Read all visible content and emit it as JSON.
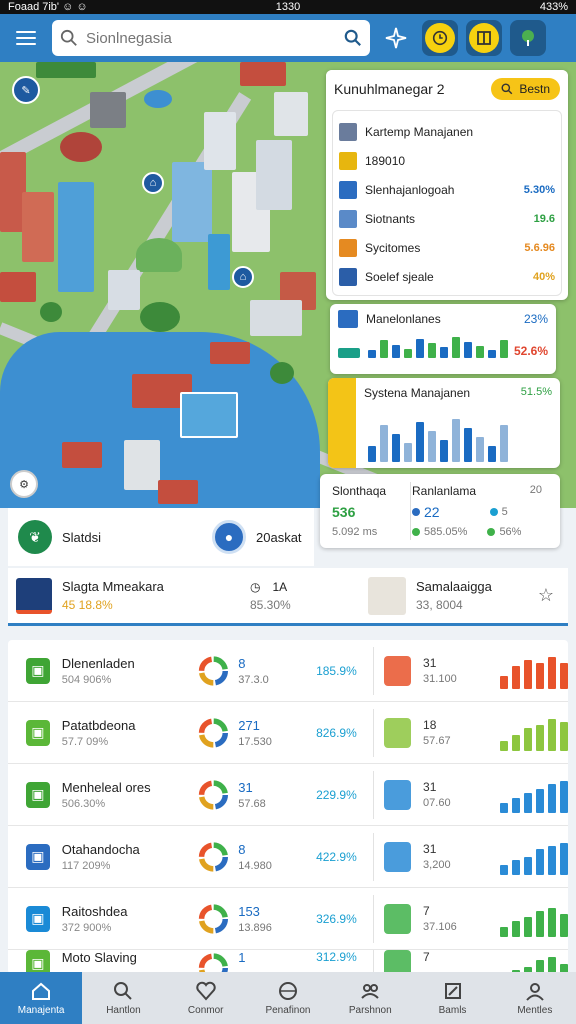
{
  "statusbar": {
    "left": "Foaad 7ib' ☺ ☺",
    "center": "1330",
    "right": "433%"
  },
  "appbar": {
    "search_placeholder": "Sionlnegasia"
  },
  "panel": {
    "title": "Kunuhlmanegar 2",
    "header_button": "Bestn",
    "items": [
      {
        "label": "Kartemp Manajanen",
        "value": "",
        "color": "#6a7c9c"
      },
      {
        "label": "189010",
        "value": "",
        "color": "#e7b60f"
      },
      {
        "label": "Slenhajanlogoah",
        "value": "5.30%",
        "color": "#2b6cc0"
      },
      {
        "label": "Siotnants",
        "value": "19.6",
        "color": "#5a8ac8"
      },
      {
        "label": "Sycitomes",
        "value": "5.6.96",
        "color": "#e58a21"
      },
      {
        "label": "Soelef sjeale",
        "value": "40%",
        "color": "#2b5ea8"
      }
    ],
    "mon_title": "Manelonlanes",
    "mon_value": "52.6%",
    "mon_top_value": "23%",
    "sys_title": "Systena Manajanen",
    "sys_value": "51.5%"
  },
  "stats": {
    "left_title": "Slonthaqa",
    "left_value": "536",
    "left_sub": "5.092 ms",
    "right_title": "Ranlanlama",
    "right_badge": "20",
    "right_value": "22",
    "right_sub1": "5",
    "right_sub2": "585.05%",
    "right_sub3": "56%"
  },
  "leftinfo": {
    "a": "Slatdsi",
    "b": "20askat"
  },
  "sysrow": {
    "title": "Slagta Mmeakara",
    "sub": "45 18.8%",
    "mid_a": "1A",
    "mid_b": "85.30%",
    "right_title": "Samalaaigga",
    "right_sub": "33, 8004"
  },
  "table": [
    {
      "name": "Dlenenladen",
      "sub": "504 906%",
      "num": "8",
      "numsub": "37.3.0",
      "pct": "185.9%",
      "n2": "31",
      "n2sub": "31.100",
      "color": "#3fa535",
      "barcolor": "#e8532b",
      "bars": [
        0.4,
        0.7,
        0.9,
        0.8,
        1.0,
        0.8
      ]
    },
    {
      "name": "Patatbdeona",
      "sub": "57.7 09%",
      "num": "271",
      "numsub": "17.530",
      "pct": "826.9%",
      "n2": "18",
      "n2sub": "57.67",
      "color": "#5bb738",
      "barcolor": "#8dc63f",
      "bars": [
        0.3,
        0.5,
        0.7,
        0.8,
        1.0,
        0.9
      ]
    },
    {
      "name": "Menheleal ores",
      "sub": "506.30%",
      "num": "31",
      "numsub": "57.68",
      "pct": "229.9%",
      "n2": "31",
      "n2sub": "07.60",
      "color": "#3fa535",
      "barcolor": "#2a8bd6",
      "bars": [
        0.3,
        0.45,
        0.6,
        0.75,
        0.9,
        1.0
      ]
    },
    {
      "name": "Otahandocha",
      "sub": "117 209%",
      "num": "8",
      "numsub": "14.980",
      "pct": "422.9%",
      "n2": "31",
      "n2sub": "3,200",
      "color": "#2b6cc0",
      "barcolor": "#2a8bd6",
      "bars": [
        0.3,
        0.45,
        0.55,
        0.8,
        0.9,
        1.0
      ]
    },
    {
      "name": "Raitoshdea",
      "sub": "372 900%",
      "num": "153",
      "numsub": "13.896",
      "pct": "326.9%",
      "n2": "7",
      "n2sub": "37.106",
      "color": "#1a8ad6",
      "barcolor": "#3fb14a",
      "bars": [
        0.3,
        0.5,
        0.6,
        0.8,
        0.9,
        0.7
      ]
    },
    {
      "name": "Moto Slaving",
      "sub": "",
      "num": "1",
      "numsub": "",
      "pct": "312.9%",
      "n2": "7",
      "n2sub": "",
      "color": "#5bb738",
      "barcolor": "#3fb14a",
      "bars": [
        0.3,
        0.5,
        0.6,
        0.8,
        0.9,
        0.7
      ]
    }
  ],
  "bottomnav": [
    {
      "label": "Manajenta",
      "icon": "home-icon"
    },
    {
      "label": "Hantlon",
      "icon": "search-icon"
    },
    {
      "label": "Conmor",
      "icon": "heart-icon"
    },
    {
      "label": "Penafinon",
      "icon": "globe-icon"
    },
    {
      "label": "Parshnon",
      "icon": "group-icon"
    },
    {
      "label": "Bamls",
      "icon": "edit-icon"
    },
    {
      "label": "Mentles",
      "icon": "profile-icon"
    }
  ]
}
